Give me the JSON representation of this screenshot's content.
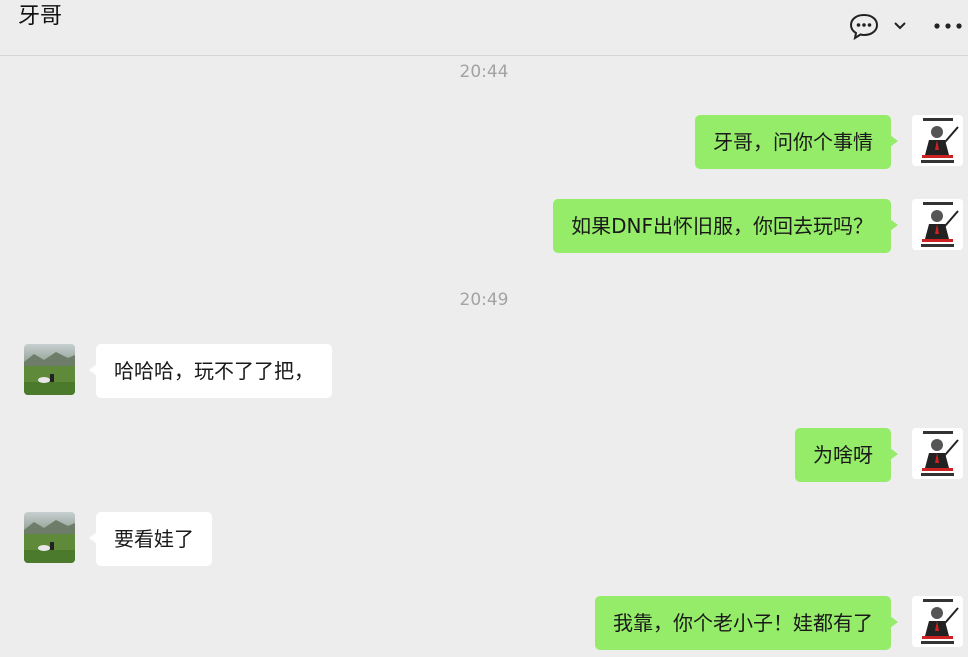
{
  "header": {
    "title": "牙哥"
  },
  "timestamps": [
    "20:44",
    "20:49"
  ],
  "messages": [
    {
      "side": "out",
      "text": "牙哥，问你个事情"
    },
    {
      "side": "out",
      "text": "如果DNF出怀旧服，你回去玩吗？"
    },
    {
      "side": "in",
      "text": "哈哈哈，玩不了了把，"
    },
    {
      "side": "out",
      "text": "为啥呀"
    },
    {
      "side": "in",
      "text": "要看娃了"
    },
    {
      "side": "out",
      "text": "我靠，你个老小子！娃都有了"
    }
  ],
  "colors": {
    "background": "#ededed",
    "outgoing_bubble": "#95ec69",
    "incoming_bubble": "#ffffff",
    "timestamp_text": "#a3a3a3"
  },
  "icons": {
    "chat": "chat-bubble-icon",
    "chevron": "chevron-down-icon",
    "more": "more-dots-icon"
  }
}
